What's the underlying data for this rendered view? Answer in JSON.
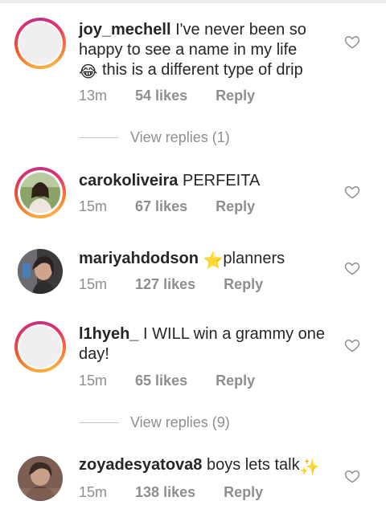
{
  "comments": [
    {
      "username": "joy_mechell",
      "text": "I've never been so happy to see a name in my life 😂 this is a different type of drip",
      "text_before_emoji": "I've never been so happy to see a name in my life",
      "emoji": "😂",
      "text_after_emoji": "this is a different type of drip",
      "time": "13m",
      "likes": "54 likes",
      "reply": "Reply",
      "view_replies": "View replies (1)"
    },
    {
      "username": "carokoliveira",
      "text": "PERFEITA",
      "time": "15m",
      "likes": "67 likes",
      "reply": "Reply"
    },
    {
      "username": "mariyahdodson",
      "emoji": "⭐",
      "text": "planners",
      "time": "15m",
      "likes": "127 likes",
      "reply": "Reply"
    },
    {
      "username": "l1hyeh_",
      "text": "I WILL win a grammy one day!",
      "time": "15m",
      "likes": "65 likes",
      "reply": "Reply",
      "view_replies": "View replies (9)"
    },
    {
      "username": "zoyadesyatova8",
      "text": "boys lets talk",
      "emoji": "✨",
      "time": "15m",
      "likes": "138 likes",
      "reply": "Reply"
    }
  ],
  "colors": {
    "text": "#262626",
    "meta": "#8e8e8e",
    "story_ring_start": "#fcaf45",
    "story_ring_end": "#c13584"
  },
  "icons": {
    "like": "heart-outline-icon"
  }
}
